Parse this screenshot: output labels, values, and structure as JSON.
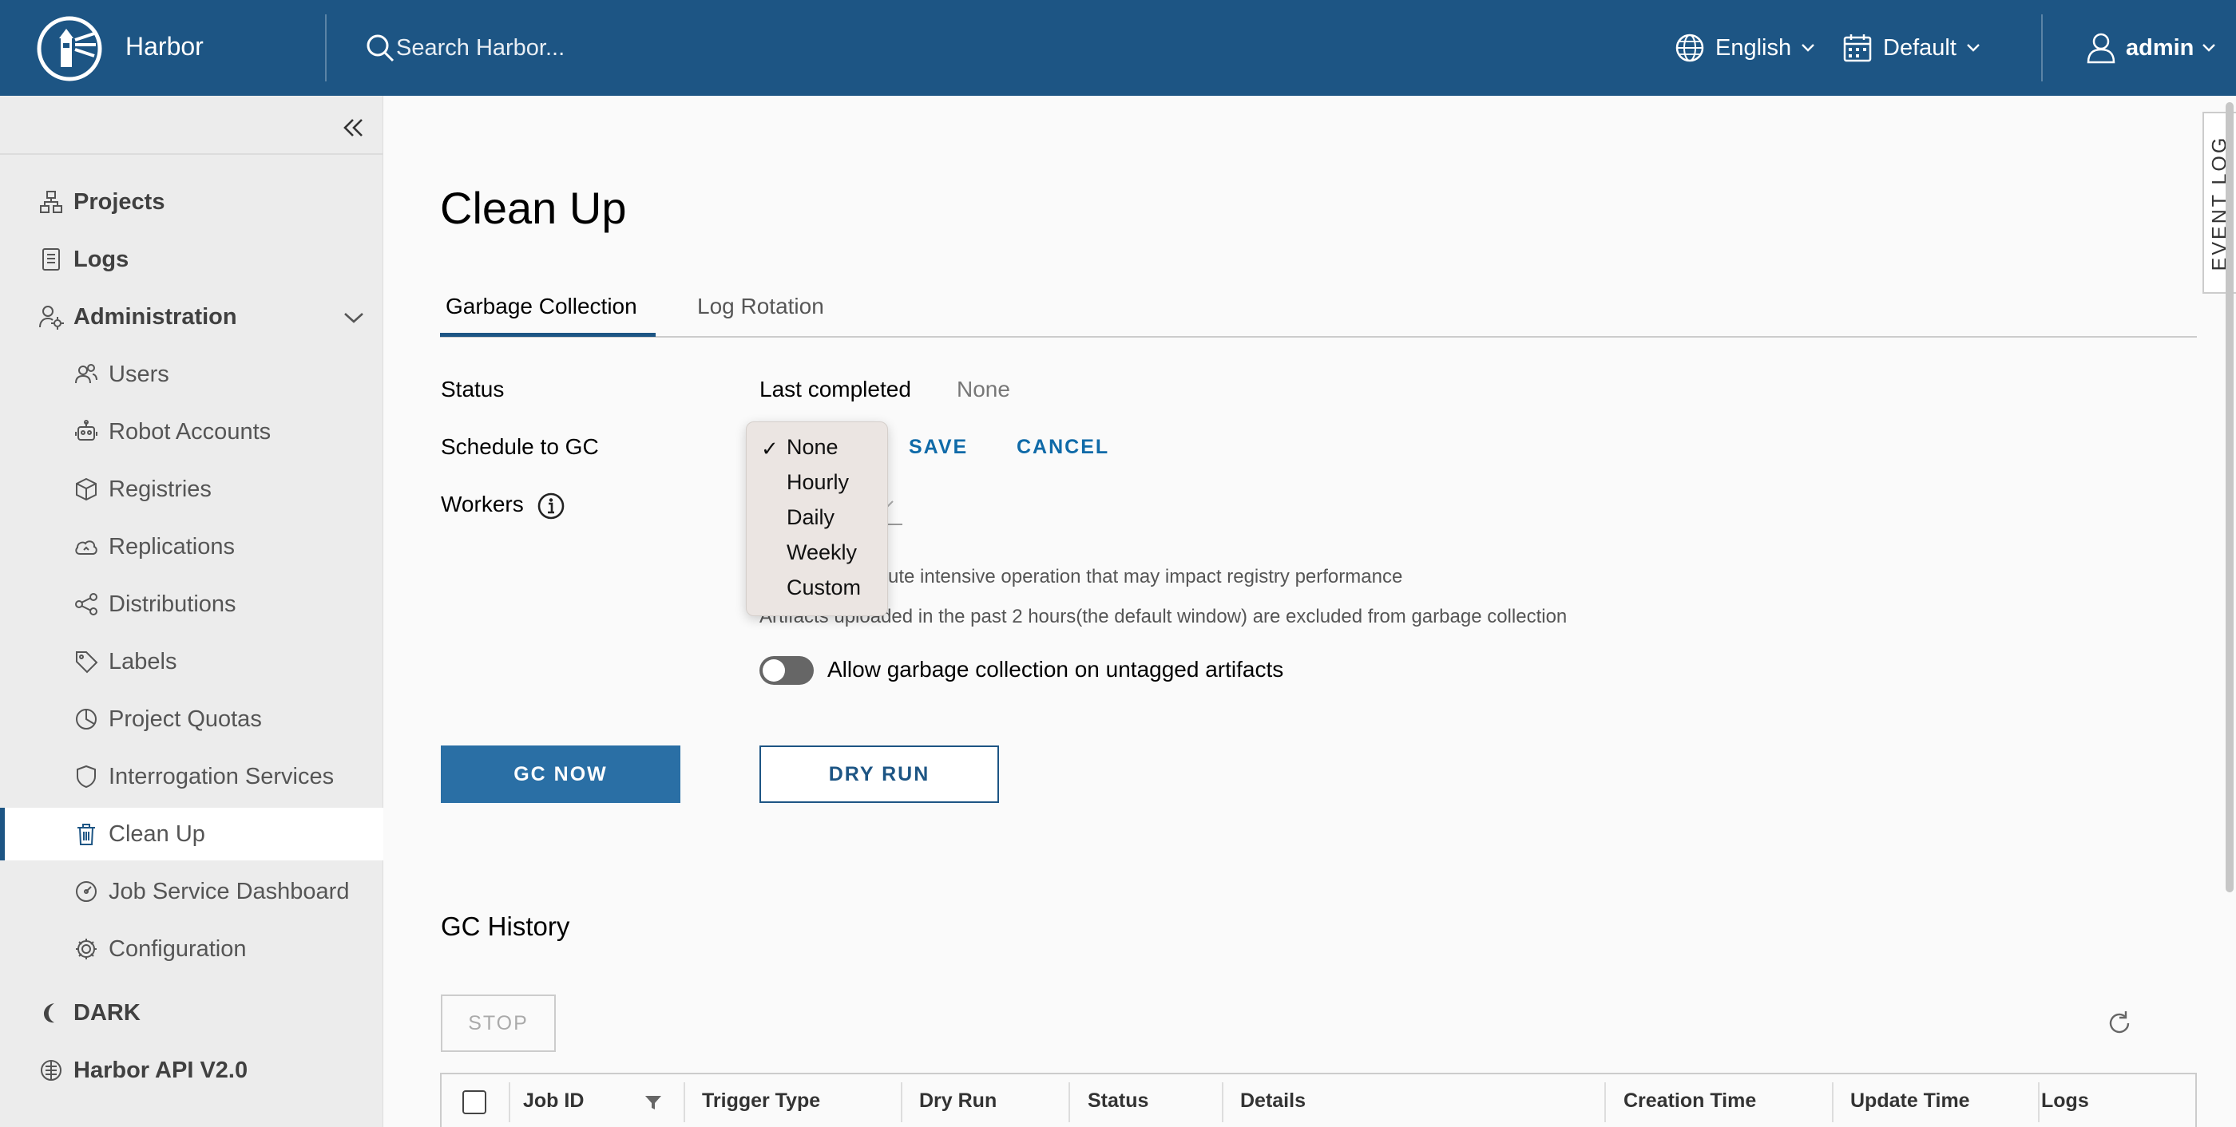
{
  "header": {
    "app_name": "Harbor",
    "search_placeholder": "Search Harbor...",
    "language": "English",
    "theme": "Default",
    "user": "admin",
    "bg_color": "#1d5584"
  },
  "sidebar": {
    "items": [
      {
        "label": "Projects",
        "icon": "projects-icon"
      },
      {
        "label": "Logs",
        "icon": "logs-icon"
      },
      {
        "label": "Administration",
        "icon": "administration-icon"
      },
      {
        "label": "Users",
        "icon": "users-icon"
      },
      {
        "label": "Robot Accounts",
        "icon": "robot-icon"
      },
      {
        "label": "Registries",
        "icon": "registries-icon"
      },
      {
        "label": "Replications",
        "icon": "replications-icon"
      },
      {
        "label": "Distributions",
        "icon": "distributions-icon"
      },
      {
        "label": "Labels",
        "icon": "labels-icon"
      },
      {
        "label": "Project Quotas",
        "icon": "quotas-icon"
      },
      {
        "label": "Interrogation Services",
        "icon": "shield-icon"
      },
      {
        "label": "Clean Up",
        "icon": "trash-icon",
        "active": true
      },
      {
        "label": "Job Service Dashboard",
        "icon": "dashboard-icon"
      },
      {
        "label": "Configuration",
        "icon": "gear-icon"
      },
      {
        "label": "DARK",
        "icon": "moon-icon"
      },
      {
        "label": "Harbor API V2.0",
        "icon": "api-icon"
      }
    ]
  },
  "main": {
    "title": "Clean Up",
    "tabs": [
      {
        "label": "Garbage Collection",
        "active": true
      },
      {
        "label": "Log Rotation"
      }
    ],
    "status_label": "Status",
    "last_completed_label": "Last completed",
    "last_completed_value": "None",
    "schedule_label": "Schedule to GC",
    "save_label": "SAVE",
    "cancel_label": "CANCEL",
    "workers_label": "Workers",
    "note1": "ute intensive operation that may impact registry performance",
    "note2": "Artifacts uploaded in the past 2 hours(the default window) are excluded from garbage collection",
    "toggle_label": "Allow garbage collection on untagged artifacts",
    "gc_now_label": "GC NOW",
    "dry_run_label": "DRY RUN",
    "gc_history_title": "GC History",
    "stop_label": "STOP",
    "table_headers": [
      "Job ID",
      "Trigger Type",
      "Dry Run",
      "Status",
      "Details",
      "Creation Time",
      "Update Time",
      "Logs"
    ]
  },
  "schedule_dropdown": {
    "options": [
      "None",
      "Hourly",
      "Daily",
      "Weekly",
      "Custom"
    ],
    "selected": "None"
  },
  "event_log_label": "EVENT LOG"
}
